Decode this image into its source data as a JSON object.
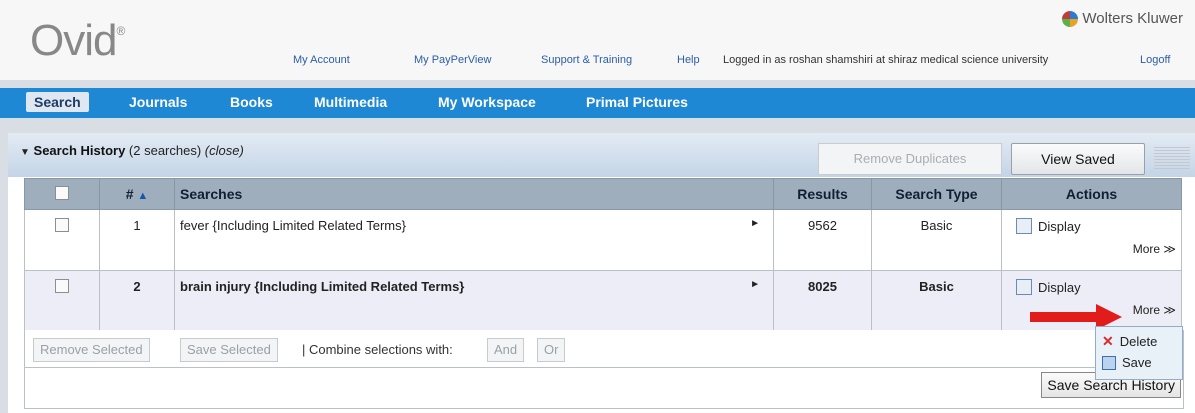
{
  "brand": {
    "logo": "Ovid",
    "logo_mark": "®",
    "company": "Wolters Kluwer"
  },
  "toplinks": {
    "my_account": "My Account",
    "my_payperview": "My PayPerView",
    "support": "Support & Training",
    "help": "Help",
    "logged_in": "Logged in as roshan shamshiri at shiraz medical science university",
    "logoff": "Logoff"
  },
  "nav": {
    "search": "Search",
    "journals": "Journals",
    "books": "Books",
    "multimedia": "Multimedia",
    "workspace": "My Workspace",
    "primal": "Primal Pictures"
  },
  "history": {
    "title": "Search History",
    "count": "(2 searches)",
    "close": "(close)",
    "remove_duplicates": "Remove Duplicates",
    "view_saved": "View Saved"
  },
  "table": {
    "headers": {
      "num": "#",
      "searches": "Searches",
      "results": "Results",
      "type": "Search Type",
      "actions": "Actions"
    },
    "rows": [
      {
        "num": "1",
        "query": "fever {Including Limited Related Terms}",
        "results": "9562",
        "type": "Basic",
        "display": "Display",
        "more": "More ≫"
      },
      {
        "num": "2",
        "query": "brain injury {Including Limited Related Terms}",
        "results": "8025",
        "type": "Basic",
        "display": "Display",
        "more": "More ≫"
      }
    ]
  },
  "footer": {
    "remove_selected": "Remove Selected",
    "save_selected": "Save Selected",
    "combine": "| Combine selections with:",
    "and": "And",
    "or": "Or",
    "save_history": "Save Search History"
  },
  "popup": {
    "delete": "Delete",
    "save": "Save"
  },
  "colors": {
    "nav": "#1e88d4",
    "link": "#2a5da8",
    "arrow": "#e21b1b"
  }
}
